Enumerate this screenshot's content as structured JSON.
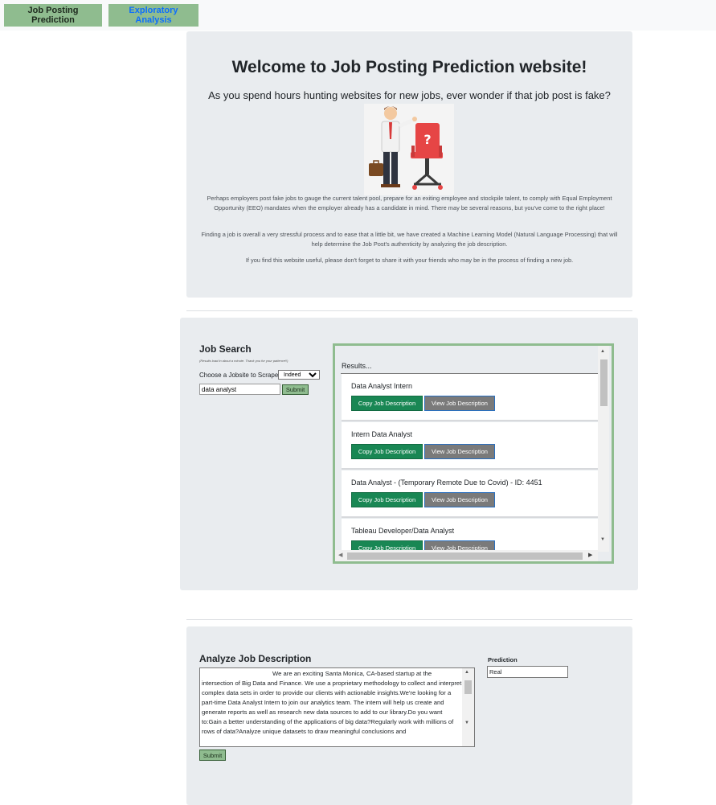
{
  "nav": {
    "prediction_label": "Job Posting Prediction",
    "analysis_label": "Exploratory Analysis"
  },
  "hero": {
    "title": "Welcome to Job Posting Prediction website!",
    "lead": "As you spend hours hunting websites for new jobs, ever wonder if that job post is fake?",
    "paragraph1": "Perhaps employers post fake jobs to gauge the current talent pool, prepare for an exiting employee and stockpile talent, to comply with Equal Employment Opportunity (EEO) mandates when the employer already has a candidate in mind. There may be several reasons, but you've come to the right place!",
    "paragraph2": "Finding a job is overall a very stressful process and to ease that a little bit, we have created a Machine Learning Model (Natural Language Processing) that will help determine the Job Post's authenticity by analyzing the job description.",
    "paragraph3": "If you find this website useful, please don't forget to share it with your friends who may be in the process of finding a new job."
  },
  "search": {
    "title": "Job Search",
    "note": "(Results load in about a minute. Thank you for your patience!!)",
    "choose_label": "Choose a Jobsite to Scrape:",
    "site_selected": "Indeed",
    "query_value": "data analyst",
    "submit_label": "Submit",
    "results_title": "Results...",
    "copy_label": "Copy Job Description",
    "view_label": "View Job Description",
    "jobs": [
      {
        "title": "Data Analyst Intern"
      },
      {
        "title": "Intern Data Analyst"
      },
      {
        "title": "Data Analyst - (Temporary Remote Due to Covid) - ID: 4451"
      },
      {
        "title": "Tableau Developer/Data Analyst"
      }
    ]
  },
  "analyze": {
    "title": "Analyze Job Description",
    "description": "We are an exciting Santa Monica, CA-based startup at the intersection of Big Data and Finance. We use a proprietary methodology to collect and interpret complex data sets in order to provide our clients with actionable insights.We're looking for a part-time Data Analyst Intern to join our analytics team. The intern will help us create and generate reports as well as research new data sources to add to our library.Do you want to:Gain a better understanding of the applications of big data?Regularly work with millions of rows of data?Analyze unique datasets to draw meaningful conclusions and",
    "submit_label": "Submit",
    "prediction_label": "Prediction",
    "prediction_value": "Real"
  },
  "colors": {
    "accent_green": "#8fbc8f",
    "copy_button": "#198754",
    "view_button": "#7a7a7a",
    "panel": "#e9ecef",
    "link_blue": "#0d6efd"
  }
}
